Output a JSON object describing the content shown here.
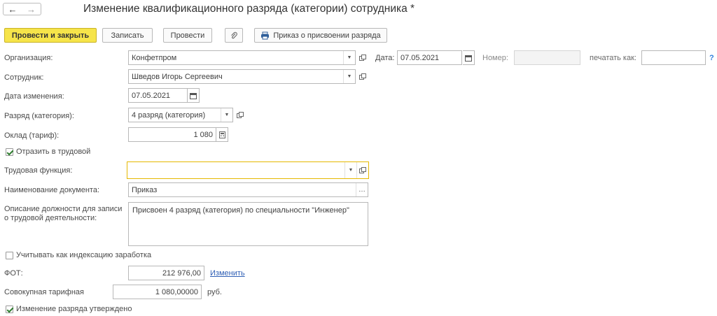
{
  "window": {
    "title": "Изменение квалификационного разряда (категории) сотрудника *",
    "nav_back": "←",
    "nav_forward": "→"
  },
  "toolbar": {
    "post_close": "Провести и закрыть",
    "save": "Записать",
    "post": "Провести",
    "print_order": "Приказ о присвоении разряда"
  },
  "form": {
    "organization": {
      "label": "Организация:",
      "value": "Конфетпром"
    },
    "date": {
      "label": "Дата:",
      "value": "07.05.2021"
    },
    "number": {
      "label": "Номер:",
      "value": ""
    },
    "print_as": {
      "label": "печатать как:",
      "value": ""
    },
    "help": "?",
    "employee": {
      "label": "Сотрудник:",
      "value": "Шведов Игорь Сергеевич"
    },
    "change_date": {
      "label": "Дата изменения:",
      "value": "07.05.2021"
    },
    "grade": {
      "label": "Разряд (категория):",
      "value": "4 разряд (категория)"
    },
    "salary": {
      "label": "Оклад (тариф):",
      "value": "1 080"
    },
    "reflect_labor": {
      "label": "Отразить в трудовой",
      "checked": true
    },
    "labor_function": {
      "label": "Трудовая функция:",
      "value": ""
    },
    "doc_name": {
      "label": "Наименование документа:",
      "value": "Приказ"
    },
    "description": {
      "label_line1": "Описание должности для записи",
      "label_line2": "о трудовой деятельности:",
      "value": "Присвоен 4 разряд (категория) по специальности \"Инженер\""
    },
    "indexation": {
      "label": "Учитывать как индексацию заработка",
      "checked": false
    },
    "fot": {
      "label": "ФОТ:",
      "value": "212 976,00",
      "change_link": "Изменить"
    },
    "total_tariff": {
      "label": "Совокупная тарифная",
      "value": "1 080,00000",
      "unit": "руб."
    },
    "approved": {
      "label": "Изменение разряда утверждено",
      "checked": true
    }
  },
  "icons": {
    "dropdown": "chevron-down-icon",
    "open": "open-form-icon",
    "calendar": "calendar-icon",
    "calculator": "calculator-icon",
    "paperclip": "paperclip-icon",
    "printer": "printer-icon",
    "ellipsis": "ellipsis-icon"
  },
  "colors": {
    "primary_button": "#f6e44a",
    "active_field_border": "#e5b800",
    "link": "#2f5fb5",
    "check": "#2f7d2f"
  }
}
